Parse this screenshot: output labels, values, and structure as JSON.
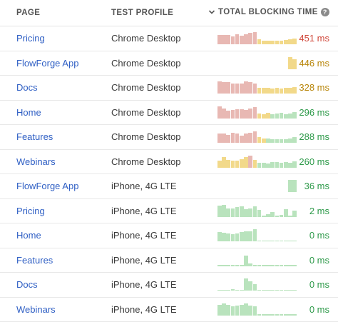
{
  "header": {
    "page_label": "PAGE",
    "profile_label": "TEST PROFILE",
    "tbt_label": "TOTAL BLOCKING TIME",
    "sort_icon": "chevron-down-icon",
    "help_icon": "question-circle-icon",
    "help_glyph": "?"
  },
  "colors": {
    "link": "#2f5fc4",
    "poor": "#e8b8b3",
    "needs_improvement": "#f2d98a",
    "good": "#b9e3bd",
    "value_poor": "#d0473a",
    "value_needs_improvement": "#b8860b",
    "value_good": "#2e9a4a"
  },
  "rows": [
    {
      "page": "Pricing",
      "profile": "Chrome Desktop",
      "value": "451 ms",
      "rating": "poor",
      "bars": [
        0.75,
        0.75,
        0.75,
        0.65,
        0.85,
        0.7,
        0.85,
        0.95,
        1.0,
        0.4,
        0.3,
        0.3,
        0.3,
        0.3,
        0.3,
        0.35,
        0.4,
        0.5
      ],
      "bar_ratings": [
        "p",
        "p",
        "p",
        "p",
        "p",
        "p",
        "p",
        "p",
        "p",
        "n",
        "n",
        "n",
        "n",
        "n",
        "n",
        "n",
        "n",
        "n"
      ]
    },
    {
      "page": "FlowForge App",
      "profile": "Chrome Desktop",
      "value": "446 ms",
      "rating": "needs_improvement",
      "bars": [
        1.0,
        0.8
      ],
      "offset": 16,
      "bar_ratings": [
        "n",
        "n"
      ]
    },
    {
      "page": "Docs",
      "profile": "Chrome Desktop",
      "value": "328 ms",
      "rating": "needs_improvement",
      "bars": [
        1.0,
        0.95,
        0.95,
        0.8,
        0.8,
        0.85,
        1.0,
        0.95,
        0.85,
        0.5,
        0.5,
        0.45,
        0.4,
        0.45,
        0.4,
        0.45,
        0.45,
        0.55
      ],
      "bar_ratings": [
        "p",
        "p",
        "p",
        "p",
        "p",
        "p",
        "p",
        "p",
        "p",
        "n",
        "n",
        "n",
        "n",
        "n",
        "n",
        "n",
        "n",
        "n"
      ]
    },
    {
      "page": "Home",
      "profile": "Chrome Desktop",
      "value": "296 ms",
      "rating": "good",
      "bars": [
        1.0,
        0.8,
        0.6,
        0.7,
        0.75,
        0.75,
        0.7,
        0.8,
        0.9,
        0.4,
        0.35,
        0.45,
        0.35,
        0.4,
        0.45,
        0.35,
        0.4,
        0.5
      ],
      "bar_ratings": [
        "p",
        "p",
        "p",
        "p",
        "p",
        "p",
        "p",
        "p",
        "p",
        "n",
        "n",
        "n",
        "g",
        "g",
        "g",
        "g",
        "g",
        "g"
      ]
    },
    {
      "page": "Features",
      "profile": "Chrome Desktop",
      "value": "288 ms",
      "rating": "good",
      "bars": [
        0.75,
        0.75,
        0.65,
        0.85,
        0.75,
        0.6,
        0.75,
        0.8,
        0.95,
        0.45,
        0.35,
        0.35,
        0.3,
        0.3,
        0.3,
        0.3,
        0.35,
        0.5
      ],
      "bar_ratings": [
        "p",
        "p",
        "p",
        "p",
        "p",
        "p",
        "p",
        "p",
        "p",
        "n",
        "n",
        "g",
        "g",
        "g",
        "g",
        "g",
        "g",
        "g"
      ]
    },
    {
      "page": "Webinars",
      "profile": "Chrome Desktop",
      "value": "260 ms",
      "rating": "good",
      "bars": [
        0.55,
        0.85,
        0.6,
        0.55,
        0.55,
        0.65,
        0.85,
        1.0,
        0.6,
        0.4,
        0.4,
        0.35,
        0.45,
        0.45,
        0.4,
        0.45,
        0.4,
        0.5
      ],
      "bar_ratings": [
        "n",
        "n",
        "n",
        "n",
        "n",
        "n",
        "n",
        "p",
        "n",
        "g",
        "g",
        "g",
        "g",
        "g",
        "g",
        "g",
        "g",
        "g"
      ]
    },
    {
      "page": "FlowForge App",
      "profile": "iPhone, 4G LTE",
      "value": "36 ms",
      "rating": "good",
      "bars": [
        1.0,
        1.0
      ],
      "offset": 16,
      "bar_ratings": [
        "g",
        "g"
      ]
    },
    {
      "page": "Pricing",
      "profile": "iPhone, 4G LTE",
      "value": "2 ms",
      "rating": "good",
      "bars": [
        0.9,
        0.95,
        0.7,
        0.65,
        0.8,
        0.85,
        0.6,
        0.7,
        0.85,
        0.55,
        0.1,
        0.2,
        0.4,
        0.05,
        0.15,
        0.6,
        0.1,
        0.5
      ],
      "bar_ratings": [
        "g",
        "g",
        "g",
        "g",
        "g",
        "g",
        "g",
        "g",
        "g",
        "g",
        "g",
        "g",
        "g",
        "g",
        "g",
        "g",
        "g",
        "g"
      ]
    },
    {
      "page": "Home",
      "profile": "iPhone, 4G LTE",
      "value": "0 ms",
      "rating": "good",
      "bars": [
        0.75,
        0.7,
        0.65,
        0.6,
        0.65,
        0.75,
        0.8,
        0.85,
        1.0,
        0.05,
        0.05,
        0.05,
        0.05,
        0.05,
        0.05,
        0.05,
        0.05,
        0.05
      ],
      "bar_ratings": [
        "g",
        "g",
        "g",
        "g",
        "g",
        "g",
        "g",
        "g",
        "g",
        "g",
        "g",
        "g",
        "g",
        "g",
        "g",
        "g",
        "g",
        "g"
      ]
    },
    {
      "page": "Features",
      "profile": "iPhone, 4G LTE",
      "value": "0 ms",
      "rating": "good",
      "bars": [
        0.05,
        0.05,
        0.05,
        0.05,
        0.05,
        0.05,
        0.85,
        0.2,
        0.05,
        0.05,
        0.05,
        0.05,
        0.05,
        0.05,
        0.05,
        0.05,
        0.05,
        0.05
      ],
      "bar_ratings": [
        "g",
        "g",
        "g",
        "g",
        "g",
        "g",
        "g",
        "g",
        "g",
        "g",
        "g",
        "g",
        "g",
        "g",
        "g",
        "g",
        "g",
        "g"
      ]
    },
    {
      "page": "Docs",
      "profile": "iPhone, 4G LTE",
      "value": "0 ms",
      "rating": "good",
      "bars": [
        0.05,
        0.05,
        0.05,
        0.1,
        0.05,
        0.05,
        1.0,
        0.75,
        0.55,
        0.05,
        0.05,
        0.05,
        0.05,
        0.05,
        0.05,
        0.05,
        0.05,
        0.05
      ],
      "bar_ratings": [
        "g",
        "g",
        "g",
        "g",
        "g",
        "g",
        "g",
        "g",
        "g",
        "g",
        "g",
        "g",
        "g",
        "g",
        "g",
        "g",
        "g",
        "g"
      ]
    },
    {
      "page": "Webinars",
      "profile": "iPhone, 4G LTE",
      "value": "0 ms",
      "rating": "good",
      "bars": [
        0.85,
        1.0,
        0.85,
        0.75,
        0.8,
        0.85,
        1.0,
        0.8,
        0.75,
        0.1,
        0.05,
        0.05,
        0.05,
        0.05,
        0.05,
        0.05,
        0.05,
        0.05
      ],
      "bar_ratings": [
        "g",
        "g",
        "g",
        "g",
        "g",
        "g",
        "g",
        "g",
        "g",
        "g",
        "g",
        "g",
        "g",
        "g",
        "g",
        "g",
        "g",
        "g"
      ]
    }
  ]
}
